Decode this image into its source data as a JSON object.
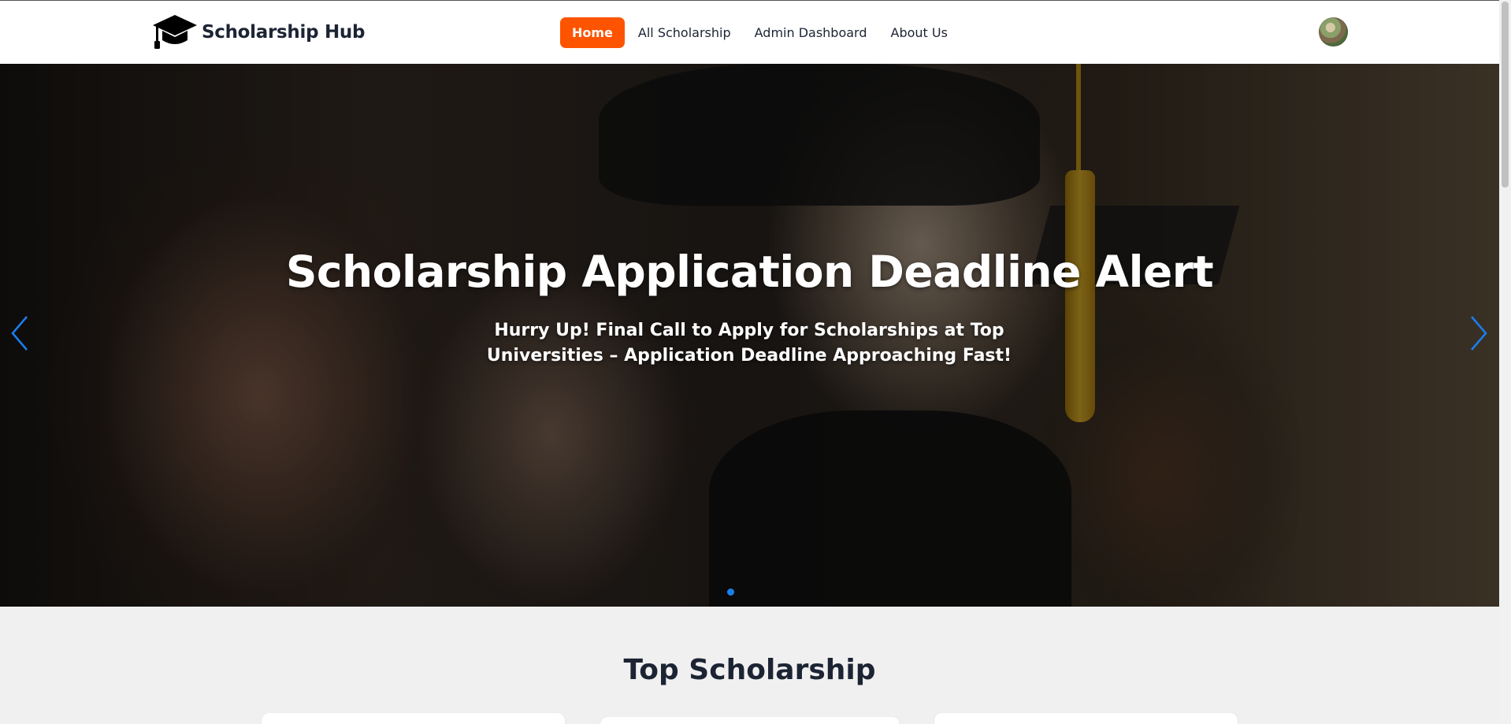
{
  "brand": {
    "name": "Scholarship Hub",
    "icon": "graduation-cap-icon"
  },
  "nav": {
    "items": [
      {
        "label": "Home",
        "active": true
      },
      {
        "label": "All Scholarship",
        "active": false
      },
      {
        "label": "Admin Dashboard",
        "active": false
      },
      {
        "label": "About Us",
        "active": false
      }
    ],
    "active_color": "#fe5400"
  },
  "user": {
    "avatar": "user-avatar"
  },
  "hero": {
    "title": "Scholarship Application Deadline Alert",
    "subtitle": "Hurry Up! Final Call to Apply for Scholarships at Top Universities – Application Deadline Approaching Fast!",
    "prev_icon": "chevron-left-icon",
    "next_icon": "chevron-right-icon",
    "slide_count": 1,
    "active_slide": 1,
    "indicator_color": "#1a7ef0"
  },
  "section": {
    "title": "Top Scholarship"
  }
}
